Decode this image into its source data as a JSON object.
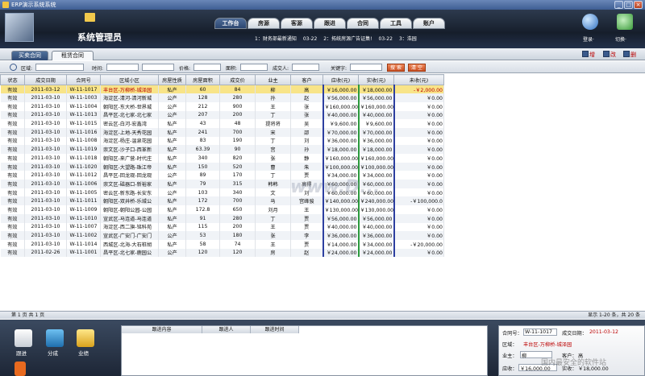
{
  "window": {
    "title": "ERP演示系统系统"
  },
  "header": {
    "system_name": "系统管理员",
    "tabs": [
      "工作台",
      "房源",
      "客源",
      "跟进",
      "合同",
      "工具",
      "账户"
    ],
    "active_tab": 0,
    "notices": [
      "1：财务部最新通知",
      "03-22",
      "2：拓统房源广告证集!",
      "03-22",
      "3：浩园"
    ],
    "login_label": "登录·",
    "switch_label": "切换·"
  },
  "subtabs": {
    "items": [
      "买卖合同",
      "租赁合同"
    ],
    "active": 0
  },
  "actions": {
    "add": "增",
    "edit": "改",
    "delete": "删"
  },
  "filter": {
    "region_label": "区域:",
    "time_label": "时间:",
    "price_label": "价格:",
    "area_label": "面积:",
    "deal_person_label": "成交人:",
    "keyword_label": "关键字:",
    "search_button": "搜 索",
    "clear_button": "清 空"
  },
  "table": {
    "columns": [
      "状态",
      "成交日期",
      "合同号",
      "区域小区",
      "房屋性质",
      "房屋面积",
      "成交价",
      "业主",
      "客户",
      "应收(元)",
      "实收(元)",
      "未收(元)"
    ],
    "rows": [
      [
        "有效",
        "2011-03-12",
        "W-11-1017",
        "丰台区-万柳桥-城泽园",
        "私产",
        "60",
        "84",
        "柳",
        "高",
        "￥16,000.00",
        "￥18,000.00",
        "-￥2,000.00"
      ],
      [
        "有效",
        "2011-03-10",
        "W-11-1003",
        "海淀区-清河-清河新城",
        "公产",
        "128",
        "280",
        "孙",
        "赵",
        "￥56,000.00",
        "￥56,000.00",
        "￥0.00"
      ],
      [
        "有效",
        "2011-03-10",
        "W-11-1004",
        "朝阳区-东大桥-世界城",
        "公产",
        "212",
        "900",
        "王",
        "张",
        "￥160,000.00",
        "￥160,000.00",
        "￥0.00"
      ],
      [
        "有效",
        "2011-03-10",
        "W-11-1013",
        "昌平区-北七家-北七家",
        "公产",
        "207",
        "200",
        "丁",
        "张",
        "￥40,000.00",
        "￥40,000.00",
        "￥0.00"
      ],
      [
        "有效",
        "2011-03-10",
        "W-11-1015",
        "密云区-白河-宏鑫湾",
        "私产",
        "43",
        "48",
        "提将将",
        "吴",
        "￥9,600.00",
        "￥9,600.00",
        "￥0.00"
      ],
      [
        "有效",
        "2011-03-10",
        "W-11-1016",
        "海淀区-上地-天秀花园",
        "私产",
        "241",
        "700",
        "宋",
        "邵",
        "￥70,000.00",
        "￥70,000.00",
        "￥0.00"
      ],
      [
        "有效",
        "2011-03-10",
        "W-11-1008",
        "海淀区-杨庄-温泉花园",
        "私产",
        "83",
        "190",
        "丁",
        "刘",
        "￥36,000.00",
        "￥36,000.00",
        "￥0.00"
      ],
      [
        "有效",
        "2011-03-10",
        "W-11-1019",
        "崇文区-沙子口-西革新",
        "私产",
        "63.39",
        "90",
        "宫",
        "孙",
        "￥18,000.00",
        "￥18,000.00",
        "￥0.00"
      ],
      [
        "有效",
        "2011-03-10",
        "W-11-1018",
        "朝阳区-来广营-时代庄",
        "私产",
        "340",
        "820",
        "张",
        "静",
        "￥160,000.00",
        "￥160,000.00",
        "￥0.00"
      ],
      [
        "有效",
        "2011-03-10",
        "W-11-1020",
        "朝阳区-大望路-珠江帝",
        "私产",
        "150",
        "520",
        "曹",
        "朱",
        "￥100,000.00",
        "￥100,000.00",
        "￥0.00"
      ],
      [
        "有效",
        "2011-03-10",
        "W-11-1012",
        "昌平区-回龙观-回龙观",
        "公产",
        "89",
        "170",
        "丁",
        "贾",
        "￥34,000.00",
        "￥34,000.00",
        "￥0.00"
      ],
      [
        "有效",
        "2011-03-10",
        "W-11-1006",
        "崇文区-磁器口-新裕家",
        "私产",
        "79",
        "315",
        "韩韩",
        "高得",
        "￥60,000.00",
        "￥60,000.00",
        "￥0.00"
      ],
      [
        "有效",
        "2011-03-10",
        "W-11-1005",
        "密云区-新东路-长安东",
        "公产",
        "103",
        "340",
        "文",
        "刘",
        "￥60,000.00",
        "￥60,000.00",
        "￥0.00"
      ],
      [
        "有效",
        "2011-03-10",
        "W-11-1011",
        "朝阳区-双井桥-乐城公",
        "私产",
        "172",
        "700",
        "马",
        "宫峰骏",
        "￥140,000.00",
        "￥240,000.00",
        "-￥100,000.0"
      ],
      [
        "有效",
        "2011-03-10",
        "W-11-1009",
        "朝阳区-朝阳公园-公园",
        "私产",
        "172.8",
        "650",
        "刘月",
        "王",
        "￥130,000.00",
        "￥130,000.00",
        "￥0.00"
      ],
      [
        "有效",
        "2011-03-10",
        "W-11-1010",
        "宣武区-马连道-马连道",
        "私产",
        "91",
        "280",
        "丁",
        "贾",
        "￥56,000.00",
        "￥56,000.00",
        "￥0.00"
      ],
      [
        "有效",
        "2011-03-10",
        "W-11-1007",
        "海淀区-西二旗-铭科苑",
        "私产",
        "115",
        "200",
        "王",
        "贾",
        "￥40,000.00",
        "￥40,000.00",
        "￥0.00"
      ],
      [
        "有效",
        "2011-03-10",
        "W-11-1002",
        "宣武区-广安门-广安门",
        "公产",
        "53",
        "180",
        "张",
        "李",
        "￥36,000.00",
        "￥36,000.00",
        "￥0.00"
      ],
      [
        "有效",
        "2011-03-10",
        "W-11-1014",
        "西城区-北海-大石桩胡",
        "私产",
        "58",
        "74",
        "王",
        "贾",
        "￥14,000.00",
        "￥34,000.00",
        "-￥20,000.00"
      ],
      [
        "有效",
        "2011-02-26",
        "W-11-1001",
        "昌平区-北七家-鹿园公",
        "公产",
        "120",
        "120",
        "房",
        "赵",
        "￥24,000.00",
        "￥24,000.00",
        "￥0.00"
      ]
    ]
  },
  "watermark": "www.D...",
  "pager": {
    "text": "第 1 页 共 1 页",
    "summary": "显示 1-20 条，共 20 条"
  },
  "bottom": {
    "icons": [
      {
        "label": "跟进",
        "icon": "notepad-icon"
      },
      {
        "label": "分成",
        "icon": "runner-icon"
      },
      {
        "label": "业绩",
        "icon": "trophy-icon"
      }
    ],
    "follow_columns": [
      "跟进内容",
      "跟进人",
      "跟进时间"
    ]
  },
  "detail": {
    "contract_label": "合同号：",
    "contract_value": "W-11-1017",
    "date_label": "成交日期：",
    "date_value": "2011-03-12",
    "region_label": "区域：",
    "region_value": "丰台区-万柳桥-城泽园",
    "owner_label": "业主：",
    "owner_value": "柳",
    "client_label": "客户：",
    "client_value": "高",
    "receivable_label": "应收：",
    "receivable_value": "￥16,000.00",
    "received_label": "实收：",
    "received_value": "￥18,000.00",
    "overlay": "国内最安全的软件站"
  }
}
